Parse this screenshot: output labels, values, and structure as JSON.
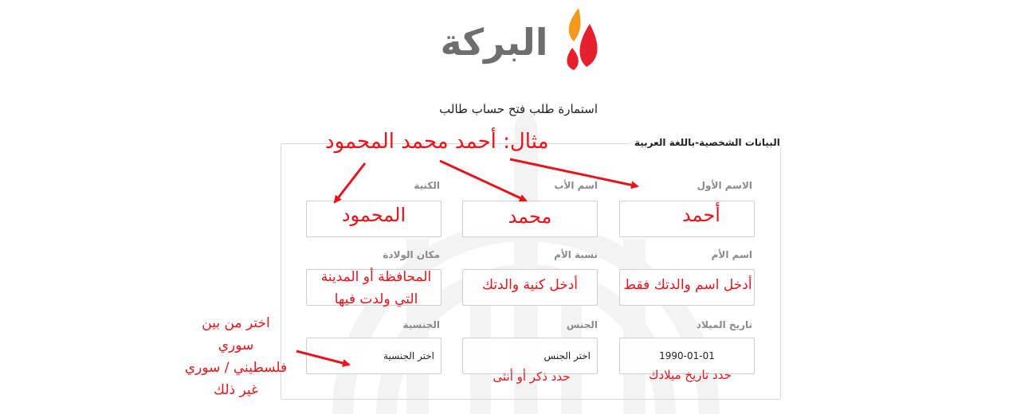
{
  "brand": {
    "name": "البركة",
    "colors": {
      "orange": "#f39a1e",
      "red": "#e5202e",
      "grey": "#6e6e6e"
    }
  },
  "form": {
    "title": "استمارة طلب فتح حساب طالب",
    "section_legend": "البيانات الشخصية-باللغة العربية"
  },
  "fields": {
    "first_name": {
      "label": "الاسم الأول",
      "value": ""
    },
    "father_name": {
      "label": "اسم الأب",
      "value": ""
    },
    "last_name": {
      "label": "الكنية",
      "value": ""
    },
    "mother_name": {
      "label": "اسم الأم",
      "value": ""
    },
    "mother_lineage": {
      "label": "نسبة الأم",
      "value": ""
    },
    "birth_place": {
      "label": "مكان الولادة",
      "value": ""
    },
    "birth_date": {
      "label": "تاريخ الميلاد",
      "value": "1990-01-01"
    },
    "gender": {
      "label": "الجنس",
      "selected": "اختر الجنس"
    },
    "nationality": {
      "label": "الجنسية",
      "selected": "اختر الجنسية"
    }
  },
  "annotations": {
    "example": "مثال: أحمد محمد المحمود",
    "first_name": "أحمد",
    "father_name": "محمد",
    "last_name": "المحمود",
    "mother_name": "أدخل اسم والدتك فقط",
    "mother_lineage": "أدخل كنية والدتك",
    "birth_place_line1": "المحافظة أو المدينة",
    "birth_place_line2": "التي ولدت فيها",
    "birth_date": "حدد تاريخ ميلادك",
    "gender": "حدد ذكر أو أنثى",
    "nationality_line1": "اختر من بين",
    "nationality_line2": "سوري",
    "nationality_line3": "فلسطيني / سوري",
    "nationality_line4": "غير ذلك",
    "color": "#e8141b"
  }
}
